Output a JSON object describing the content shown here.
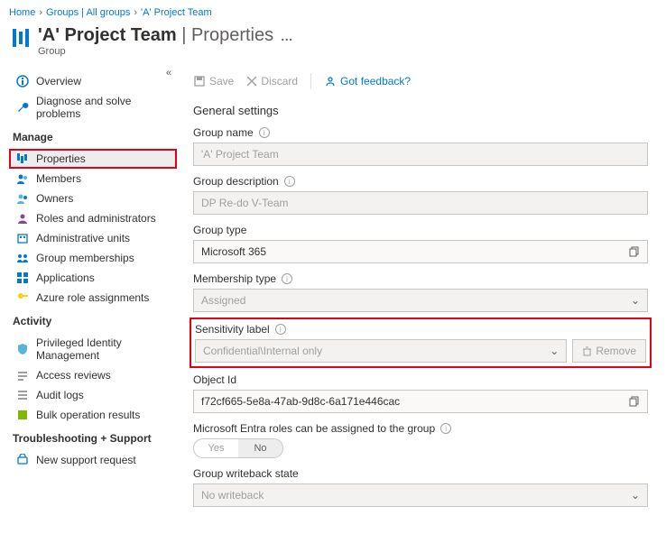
{
  "breadcrumb": {
    "items": [
      "Home",
      "Groups | All groups",
      "'A' Project Team"
    ]
  },
  "header": {
    "title_main": "'A' Project Team",
    "title_sub": "Properties",
    "kind": "Group",
    "ellipsis": "…"
  },
  "toolbar": {
    "save": "Save",
    "discard": "Discard",
    "feedback": "Got feedback?"
  },
  "nav": {
    "overview": "Overview",
    "diagnose": "Diagnose and solve problems",
    "manage_header": "Manage",
    "properties": "Properties",
    "members": "Members",
    "owners": "Owners",
    "roles": "Roles and administrators",
    "admin_units": "Administrative units",
    "group_memberships": "Group memberships",
    "applications": "Applications",
    "azure_role": "Azure role assignments",
    "activity_header": "Activity",
    "pim": "Privileged Identity Management",
    "access_reviews": "Access reviews",
    "audit_logs": "Audit logs",
    "bulk_results": "Bulk operation results",
    "troubleshoot_header": "Troubleshooting + Support",
    "new_support": "New support request"
  },
  "form": {
    "section": "General settings",
    "group_name_label": "Group name",
    "group_name_value": "'A' Project Team",
    "group_desc_label": "Group description",
    "group_desc_value": "DP Re-do V-Team",
    "group_type_label": "Group type",
    "group_type_value": "Microsoft 365",
    "membership_type_label": "Membership type",
    "membership_type_value": "Assigned",
    "sensitivity_label": "Sensitivity label",
    "sensitivity_value": "Confidential\\Internal only",
    "remove_btn": "Remove",
    "object_id_label": "Object Id",
    "object_id_value": "f72cf665-5e8a-47ab-9d8c-6a171e446cac",
    "entra_roles_label": "Microsoft Entra roles can be assigned to the group",
    "yes": "Yes",
    "no": "No",
    "writeback_label": "Group writeback state",
    "writeback_value": "No writeback"
  }
}
